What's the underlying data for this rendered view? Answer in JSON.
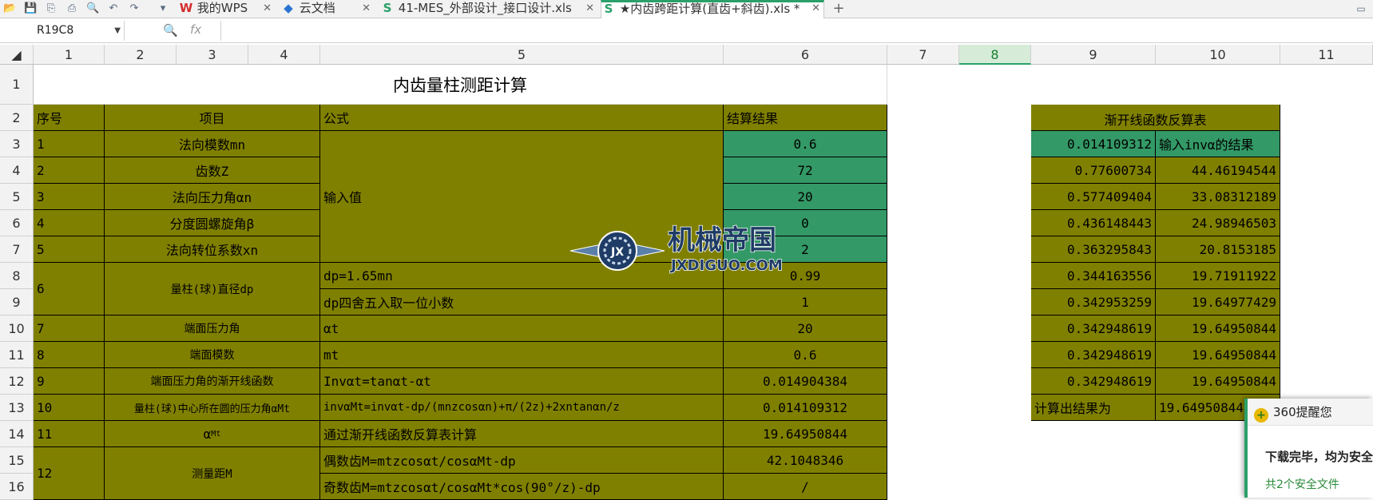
{
  "quick_access": [
    {
      "name": "open-icon",
      "glyph": "📂"
    },
    {
      "name": "save-icon",
      "glyph": "💾"
    },
    {
      "name": "export-icon",
      "glyph": "⎘"
    },
    {
      "name": "print-icon",
      "glyph": "⎙"
    },
    {
      "name": "print-preview-icon",
      "glyph": "🔍"
    },
    {
      "name": "undo-icon",
      "glyph": "↶"
    },
    {
      "name": "redo-icon",
      "glyph": "↷"
    },
    {
      "name": "more-dropdown-icon",
      "glyph": "▾"
    }
  ],
  "tabs": [
    {
      "label": "我的WPS",
      "icon": "W",
      "icon_color": "#d42b2b",
      "closable": true
    },
    {
      "label": "云文档",
      "icon": "◆",
      "icon_color": "#2a74d2",
      "closable": true
    },
    {
      "label": "41-MES_外部设计_接口设计.xls",
      "icon": "S",
      "icon_color": "#2aa06a",
      "closable": true
    },
    {
      "label": "★内齿跨距计算(直齿+斜齿).xls *",
      "icon": "S",
      "icon_color": "#2aa06a",
      "closable": true,
      "active": true
    }
  ],
  "new_tab_glyph": "+",
  "tab_close_glyph": "✕",
  "formula_bar": {
    "name_box": "R19C8",
    "fx_label": "fx",
    "formula": ""
  },
  "columns": [
    "1",
    "2",
    "3",
    "4",
    "5",
    "6",
    "7",
    "8",
    "9",
    "10",
    "11"
  ],
  "rows": [
    "1",
    "2",
    "3",
    "4",
    "5",
    "6",
    "7",
    "8",
    "9",
    "10",
    "11",
    "12",
    "13",
    "14",
    "15",
    "16"
  ],
  "selected_column": "8",
  "sheet": {
    "title": "内齿量柱测距计算",
    "headers": {
      "no": "序号",
      "item": "项目",
      "formula": "公式",
      "result": "结算结果"
    },
    "input_label": "输入值",
    "rows": [
      {
        "no": "1",
        "item": "法向模数mn",
        "result": "0.6"
      },
      {
        "no": "2",
        "item": "齿数Z",
        "result": "72"
      },
      {
        "no": "3",
        "item": "法向压力角αn",
        "result": "20"
      },
      {
        "no": "4",
        "item": "分度圆螺旋角β",
        "result": "0"
      },
      {
        "no": "5",
        "item": "法向转位系数xn",
        "result": "2"
      },
      {
        "no": "6",
        "item": "量柱(球)直径dp",
        "formula": "dp=1.65mn",
        "result": "0.99"
      },
      {
        "formula": "dp四舍五入取一位小数",
        "result": "1"
      },
      {
        "no": "7",
        "item": "端面压力角",
        "formula": "αt",
        "result": "20"
      },
      {
        "no": "8",
        "item": "端面模数",
        "formula": "mt",
        "result": "0.6"
      },
      {
        "no": "9",
        "item": "端面压力角的渐开线函数",
        "formula": "Invαt=tanαt-αt",
        "result": "0.014904384"
      },
      {
        "no": "10",
        "item": "量柱(球)中心所在圆的压力角αMt",
        "formula": "invαMt=invαt-dp/(mnzcosαn)+π/(2z)+2xntanαn/z",
        "result": "0.014109312"
      },
      {
        "no": "11",
        "item": "α",
        "item_sub": "Mt",
        "formula": "通过渐开线函数反算表计算",
        "result": "19.64950844"
      },
      {
        "no": "12",
        "item": "测量距M",
        "formula": "偶数齿M=mtzcosαt/cosαMt-dp",
        "result": "42.1048346"
      },
      {
        "formula": "奇数齿M=mtzcosαt/cosαMt*cos(90°/z)-dp",
        "result": "/"
      }
    ],
    "inverse_table": {
      "title": "渐开线函数反算表",
      "input_value": "0.014109312",
      "input_note": "输入invα的结果",
      "rows": [
        [
          "0.77600734",
          "44.46194544"
        ],
        [
          "0.577409404",
          "33.08312189"
        ],
        [
          "0.436148443",
          "24.98946503"
        ],
        [
          "0.363295843",
          "20.8153185"
        ],
        [
          "0.344163556",
          "19.71911922"
        ],
        [
          "0.342953259",
          "19.64977429"
        ],
        [
          "0.342948619",
          "19.64950844"
        ],
        [
          "0.342948619",
          "19.64950844"
        ],
        [
          "0.342948619",
          "19.64950844"
        ]
      ],
      "result_label": "计算出结果为",
      "result_value": "19.64950844"
    }
  },
  "watermark": {
    "cn": "机械帝国",
    "en": "JXDIGUO.COM",
    "emblem": "JX"
  },
  "popup": {
    "title": "360提醒您",
    "message": "下载完毕，均为安全文件",
    "link": "共2个安全文件"
  },
  "colors": {
    "olive": "#808000",
    "teal": "#339966",
    "accent": "#2aa06a"
  }
}
